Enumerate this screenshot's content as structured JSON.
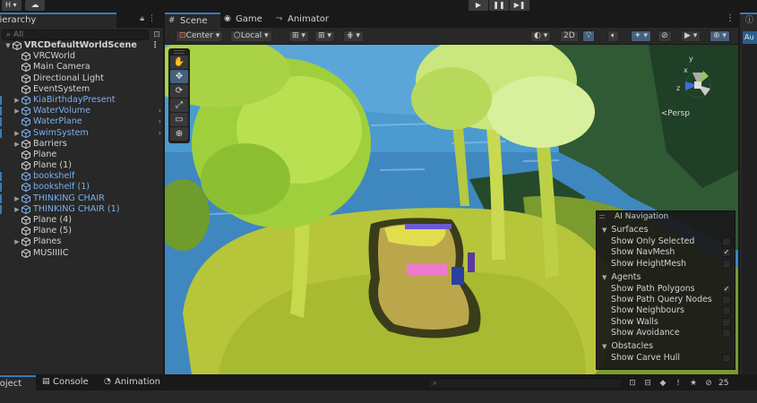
{
  "topbar": {
    "menu_label": "H ▾",
    "cloud_icon": "cloud-icon",
    "play_controls": [
      "▶",
      "❚❚",
      "▶❚"
    ]
  },
  "hierarchy": {
    "tab_label": "Hierarchy",
    "search_placeholder": "All",
    "items": [
      {
        "label": "VRCDefaultWorldScene",
        "depth": 0,
        "arrow": "▼",
        "type": "scene"
      },
      {
        "label": "VRCWorld",
        "depth": 1,
        "arrow": "",
        "type": "object"
      },
      {
        "label": "Main Camera",
        "depth": 1,
        "arrow": "",
        "type": "object"
      },
      {
        "label": "Directional Light",
        "depth": 1,
        "arrow": "",
        "type": "object"
      },
      {
        "label": "EventSystem",
        "depth": 1,
        "arrow": "",
        "type": "object"
      },
      {
        "label": "KiaBirthdayPresent",
        "depth": 1,
        "arrow": "▶",
        "type": "prefab"
      },
      {
        "label": "WaterVolume",
        "depth": 1,
        "arrow": "▶",
        "type": "prefab",
        "has_child_arrow": true
      },
      {
        "label": "WaterPlane",
        "depth": 1,
        "arrow": "",
        "type": "prefab",
        "has_child_arrow": true
      },
      {
        "label": "SwimSystem",
        "depth": 1,
        "arrow": "▶",
        "type": "prefab",
        "has_child_arrow": true
      },
      {
        "label": "Barriers",
        "depth": 1,
        "arrow": "▶",
        "type": "object"
      },
      {
        "label": "Plane",
        "depth": 1,
        "arrow": "",
        "type": "object"
      },
      {
        "label": "Plane (1)",
        "depth": 1,
        "arrow": "",
        "type": "object"
      },
      {
        "label": "bookshelf",
        "depth": 1,
        "arrow": "",
        "type": "prefab"
      },
      {
        "label": "bookshelf (1)",
        "depth": 1,
        "arrow": "",
        "type": "prefab"
      },
      {
        "label": "THINKING CHAIR",
        "depth": 1,
        "arrow": "▶",
        "type": "prefab"
      },
      {
        "label": "THINKING CHAIR (1)",
        "depth": 1,
        "arrow": "▶",
        "type": "prefab"
      },
      {
        "label": "Plane (4)",
        "depth": 1,
        "arrow": "",
        "type": "object"
      },
      {
        "label": "Plane (5)",
        "depth": 1,
        "arrow": "",
        "type": "object"
      },
      {
        "label": "Planes",
        "depth": 1,
        "arrow": "▶",
        "type": "object"
      },
      {
        "label": "MUSIIIIC",
        "depth": 1,
        "arrow": "",
        "type": "object"
      }
    ]
  },
  "scene": {
    "tabs": [
      {
        "label": "Scene",
        "icon": "grid-icon",
        "active": true
      },
      {
        "label": "Game",
        "icon": "gamepad-icon",
        "active": false
      },
      {
        "label": "Animator",
        "icon": "animator-icon",
        "active": false
      }
    ],
    "toolbar": {
      "pivot_label": "Center",
      "space_label": "Local",
      "mode_2d_label": "2D"
    },
    "tools": [
      "✋",
      "✥",
      "⟳",
      "⤢",
      "▭",
      "⊕"
    ],
    "persp_label": "<Persp",
    "gizmo_axes": {
      "x": "x",
      "y": "y",
      "z": "z"
    }
  },
  "ai_navigation": {
    "title": "AI Navigation",
    "sections": [
      {
        "name": "Surfaces",
        "options": [
          {
            "label": "Show Only Selected",
            "checked": false
          },
          {
            "label": "Show NavMesh",
            "checked": true
          },
          {
            "label": "Show HeightMesh",
            "checked": false
          }
        ]
      },
      {
        "name": "Agents",
        "options": [
          {
            "label": "Show Path Polygons",
            "checked": true
          },
          {
            "label": "Show Path Query Nodes",
            "checked": false
          },
          {
            "label": "Show Neighbours",
            "checked": false
          },
          {
            "label": "Show Walls",
            "checked": false
          },
          {
            "label": "Show Avoidance",
            "checked": false
          }
        ]
      },
      {
        "name": "Obstacles",
        "options": [
          {
            "label": "Show Carve Hull",
            "checked": false
          }
        ]
      }
    ]
  },
  "inspector": {
    "tab_icon": "info-icon",
    "button_label": "Au"
  },
  "bottom": {
    "tabs": [
      {
        "label": "Project",
        "icon": "",
        "active": true
      },
      {
        "label": "Console",
        "icon": "console-icon",
        "active": false
      },
      {
        "label": "Animation",
        "icon": "animation-icon",
        "active": false
      }
    ],
    "hidden_count": "25"
  },
  "colors": {
    "accent": "#3a79bb",
    "prefab_text": "#7bb0ef",
    "panel_bg": "#282828",
    "dark_bg": "#191919"
  }
}
